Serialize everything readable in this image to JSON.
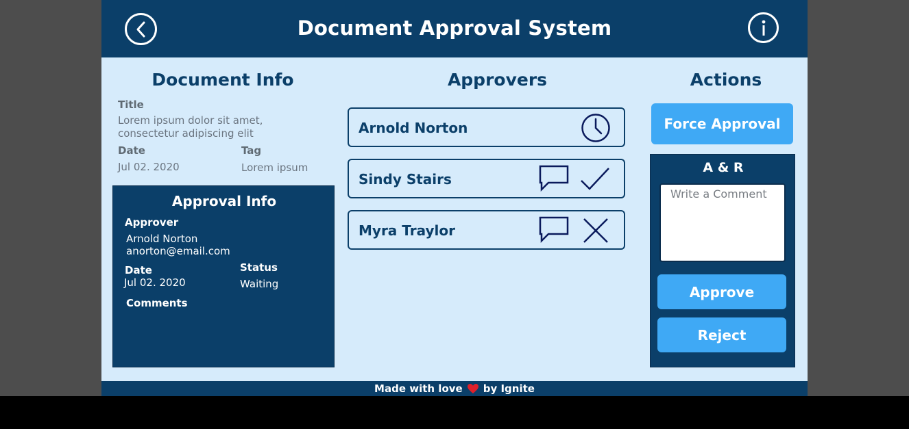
{
  "header": {
    "title": "Document Approval System",
    "back_icon": "chevron-left-icon",
    "info_icon": "info-icon"
  },
  "document_info": {
    "heading": "Document Info",
    "title_label": "Title",
    "title_value": "Lorem ipsum dolor sit amet, consectetur adipiscing elit",
    "date_label": "Date",
    "date_value": "Jul 02. 2020",
    "tag_label": "Tag",
    "tag_value": "Lorem ipsum"
  },
  "approval_info": {
    "heading": "Approval Info",
    "approver_label": "Approver",
    "approver_name": "Arnold Norton",
    "approver_email": "anorton@email.com",
    "date_label": "Date",
    "date_value": "Jul 02. 2020",
    "status_label": "Status",
    "status_value": "Waiting",
    "comments_label": "Comments"
  },
  "approvers": {
    "heading": "Approvers",
    "items": [
      {
        "name": "Arnold Norton",
        "icons": [
          "clock-icon"
        ]
      },
      {
        "name": "Sindy Stairs",
        "icons": [
          "comment-icon",
          "checkmark-icon"
        ]
      },
      {
        "name": "Myra Traylor",
        "icons": [
          "comment-icon",
          "close-icon"
        ]
      }
    ]
  },
  "actions": {
    "heading": "Actions",
    "force_approval_label": "Force Approval",
    "ar_heading": "A & R",
    "comment_placeholder": "Write a Comment",
    "approve_label": "Approve",
    "reject_label": "Reject"
  },
  "footer": {
    "prefix": "Made with love",
    "suffix": "by Ignite",
    "heart_icon": "heart-icon"
  },
  "colors": {
    "primary_dark": "#0b3f69",
    "background_light": "#d6ebfb",
    "accent_button": "#3fa9f5",
    "icon_navy": "#0a1a5c",
    "heart": "#e0202a"
  }
}
